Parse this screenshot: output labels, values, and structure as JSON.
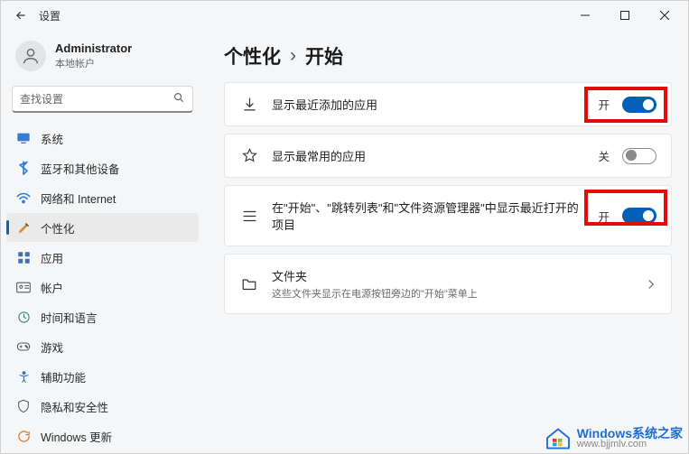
{
  "window": {
    "title": "设置"
  },
  "account": {
    "name": "Administrator",
    "sub": "本地帐户"
  },
  "search": {
    "placeholder": "查找设置"
  },
  "sidebar": {
    "items": [
      {
        "label": "系统"
      },
      {
        "label": "蓝牙和其他设备"
      },
      {
        "label": "网络和 Internet"
      },
      {
        "label": "个性化"
      },
      {
        "label": "应用"
      },
      {
        "label": "帐户"
      },
      {
        "label": "时间和语言"
      },
      {
        "label": "游戏"
      },
      {
        "label": "辅助功能"
      },
      {
        "label": "隐私和安全性"
      },
      {
        "label": "Windows 更新"
      }
    ]
  },
  "crumbs": {
    "parent": "个性化",
    "current": "开始"
  },
  "settings": [
    {
      "title": "显示最近添加的应用",
      "state": "开",
      "on": true
    },
    {
      "title": "显示最常用的应用",
      "state": "关",
      "on": false
    },
    {
      "title": "在\"开始\"、\"跳转列表\"和\"文件资源管理器\"中显示最近打开的项目",
      "state": "开",
      "on": true
    }
  ],
  "folders": {
    "title": "文件夹",
    "sub": "这些文件夹显示在电源按钮旁边的\"开始\"菜单上"
  },
  "watermark": {
    "brand": "Windows系统之家",
    "url": "www.bjjmlv.com"
  }
}
